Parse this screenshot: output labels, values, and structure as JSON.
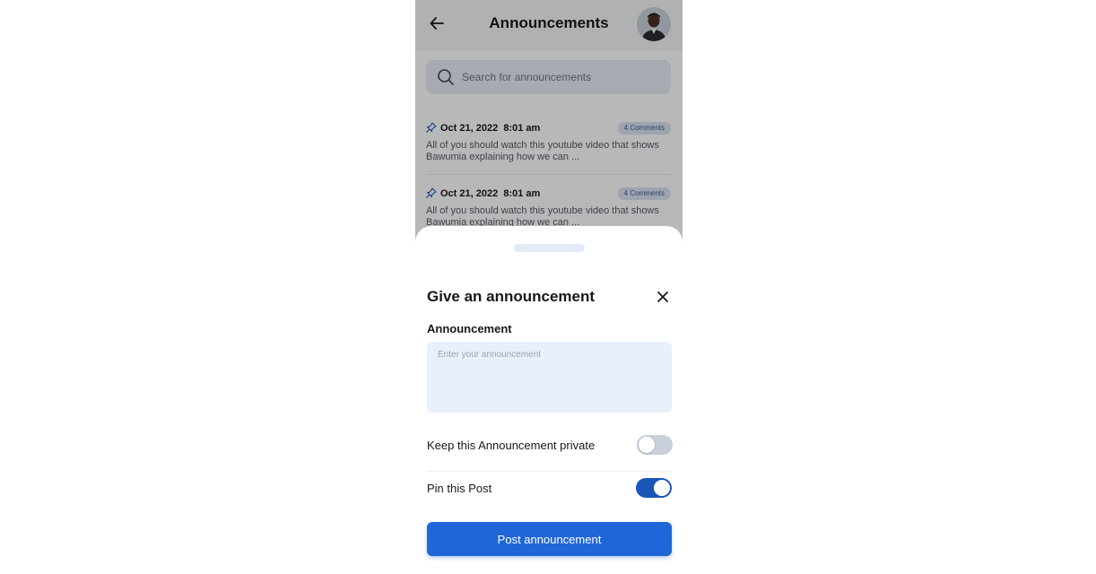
{
  "header": {
    "title": "Announcements",
    "back_icon": "arrow-left-icon",
    "avatar_icon": "user-avatar"
  },
  "search": {
    "placeholder": "Search for announcements",
    "icon": "search-icon"
  },
  "announcements": [
    {
      "date": "Oct 21, 2022  8:01 am",
      "comments": "4 Comments",
      "excerpt": "All of you should watch this youtube video that shows Bawumia explaining how we can ..."
    },
    {
      "date": "Oct 21, 2022  8:01 am",
      "comments": "4 Comments",
      "excerpt": "All of you should watch this youtube video that shows Bawumia explaining how we can ..."
    }
  ],
  "sheet": {
    "title": "Give an announcement",
    "field_label": "Announcement",
    "field_placeholder": "Enter your announcement",
    "private_label": "Keep this Announcement private",
    "private_on": false,
    "pin_label": "Pin this Post",
    "pin_on": true,
    "submit_label": "Post announcement"
  },
  "colors": {
    "primary": "#1f66d8",
    "toggle_on": "#1a56b8",
    "input_bg": "#e8f0fb",
    "text_dark": "#16181d"
  }
}
